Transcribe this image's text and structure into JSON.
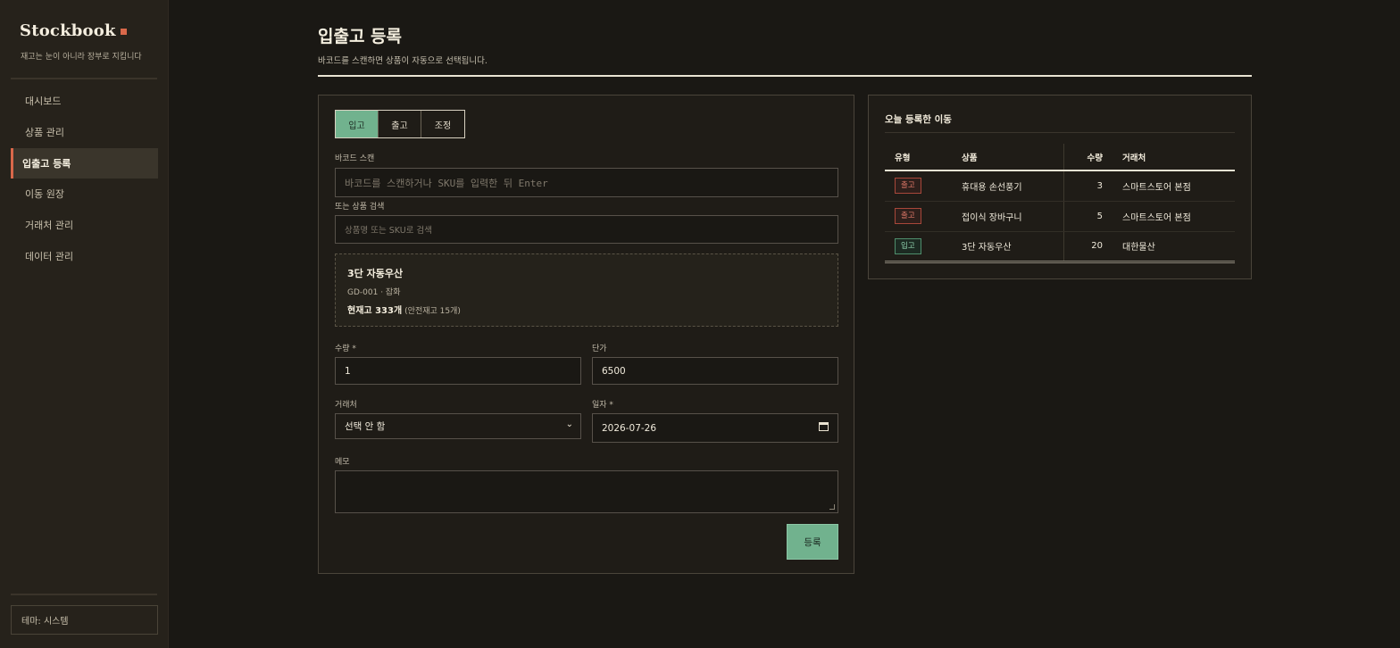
{
  "sidebar": {
    "brand": "Stockbook",
    "tagline": "재고는 눈이 아니라 장부로 지킵니다",
    "nav": [
      {
        "label": "대시보드",
        "active": false
      },
      {
        "label": "상품 관리",
        "active": false
      },
      {
        "label": "입출고 등록",
        "active": true
      },
      {
        "label": "이동 원장",
        "active": false
      },
      {
        "label": "거래처 관리",
        "active": false
      },
      {
        "label": "데이터 관리",
        "active": false
      }
    ],
    "theme_label": "테마: 시스템"
  },
  "header": {
    "title": "입출고 등록",
    "subtitle": "바코드를 스캔하면 상품이 자동으로 선택됩니다."
  },
  "form": {
    "tabs": [
      {
        "label": "입고",
        "active": true
      },
      {
        "label": "출고",
        "active": false
      },
      {
        "label": "조정",
        "active": false
      }
    ],
    "barcode_label": "바코드 스캔",
    "barcode_placeholder": "바코드를 스캔하거나 SKU를 입력한 뒤 Enter",
    "search_label": "또는 상품 검색",
    "search_placeholder": "상품명 또는 SKU로 검색",
    "product": {
      "name": "3단 자동우산",
      "meta": "GD-001 · 잡화",
      "stock": "현재고 333개",
      "safety": "(안전재고 15개)"
    },
    "qty_label": "수량 *",
    "qty_value": "1",
    "price_label": "단가",
    "price_value": "6500",
    "partner_label": "거래처",
    "partner_value": "선택 안 함",
    "date_label": "일자 *",
    "date_value": "2026-07-26",
    "memo_label": "메모",
    "memo_value": "",
    "submit_label": "등록"
  },
  "log": {
    "title": "오늘 등록한 이동",
    "columns": [
      "유형",
      "상품",
      "수량",
      "거래처"
    ],
    "rows": [
      {
        "type": "출고",
        "kind": "out",
        "product": "휴대용 손선풍기",
        "qty": "3",
        "partner": "스마트스토어 본점"
      },
      {
        "type": "출고",
        "kind": "out",
        "product": "접이식 장바구니",
        "qty": "5",
        "partner": "스마트스토어 본점"
      },
      {
        "type": "입고",
        "kind": "in",
        "product": "3단 자동우산",
        "qty": "20",
        "partner": "대한물산"
      }
    ]
  },
  "colors": {
    "accent_green": "#71b28e",
    "accent_orange": "#d9684a",
    "background": "#1a1814",
    "sidebar": "#26221b"
  }
}
